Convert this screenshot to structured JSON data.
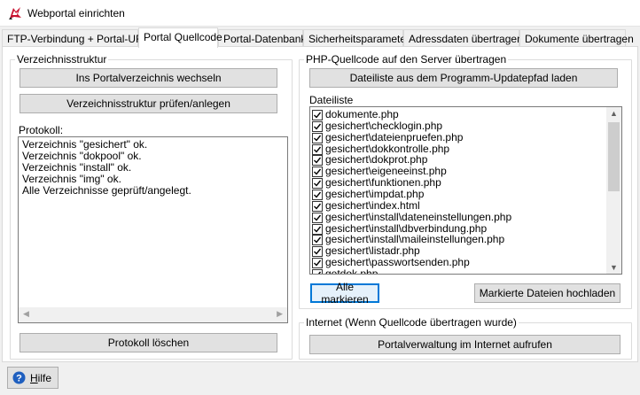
{
  "window": {
    "title": "Webportal einrichten",
    "icon": "app-icon"
  },
  "tabs": [
    {
      "label": "FTP-Verbindung + Portal-URL"
    },
    {
      "label": "Portal Quellcode"
    },
    {
      "label": "Portal-Datenbank"
    },
    {
      "label": "Sicherheitsparameter"
    },
    {
      "label": "Adressdaten übertragen"
    },
    {
      "label": "Dokumente übertragen"
    }
  ],
  "dir_group": {
    "title": "Verzeichnisstruktur",
    "switch_button": "Ins Portalverzeichnis wechseln",
    "check_button": "Verzeichnisstruktur prüfen/anlegen",
    "protocol_label": "Protokoll:",
    "protocol_lines": [
      "Verzeichnis \"gesichert\" ok.",
      "Verzeichnis \"dokpool\" ok.",
      "Verzeichnis \"install\" ok.",
      "Verzeichnis \"img\" ok.",
      "Alle Verzeichnisse geprüft/angelegt."
    ],
    "clear_button": "Protokoll löschen"
  },
  "php_group": {
    "title": "PHP-Quellcode auf den Server übertragen",
    "load_button": "Dateiliste aus dem Programm-Updatepfad laden",
    "list_label": "Dateiliste",
    "files": [
      "dokumente.php",
      "gesichert\\checklogin.php",
      "gesichert\\dateienpruefen.php",
      "gesichert\\dokkontrolle.php",
      "gesichert\\dokprot.php",
      "gesichert\\eigeneeinst.php",
      "gesichert\\funktionen.php",
      "gesichert\\impdat.php",
      "gesichert\\index.html",
      "gesichert\\install\\dateneinstellungen.php",
      "gesichert\\install\\dbverbindung.php",
      "gesichert\\install\\maileinstellungen.php",
      "gesichert\\listadr.php",
      "gesichert\\passwortsenden.php",
      "getdok.php"
    ],
    "mark_all_button": "Alle markieren",
    "upload_button": "Markierte Dateien hochladen"
  },
  "internet_group": {
    "title": "Internet (Wenn Quellcode übertragen wurde)",
    "open_button": "Portalverwaltung im Internet aufrufen"
  },
  "help": {
    "label_prefix": "",
    "label_underlined": "H",
    "label_rest": "ilfe",
    "icon": "help-icon"
  }
}
